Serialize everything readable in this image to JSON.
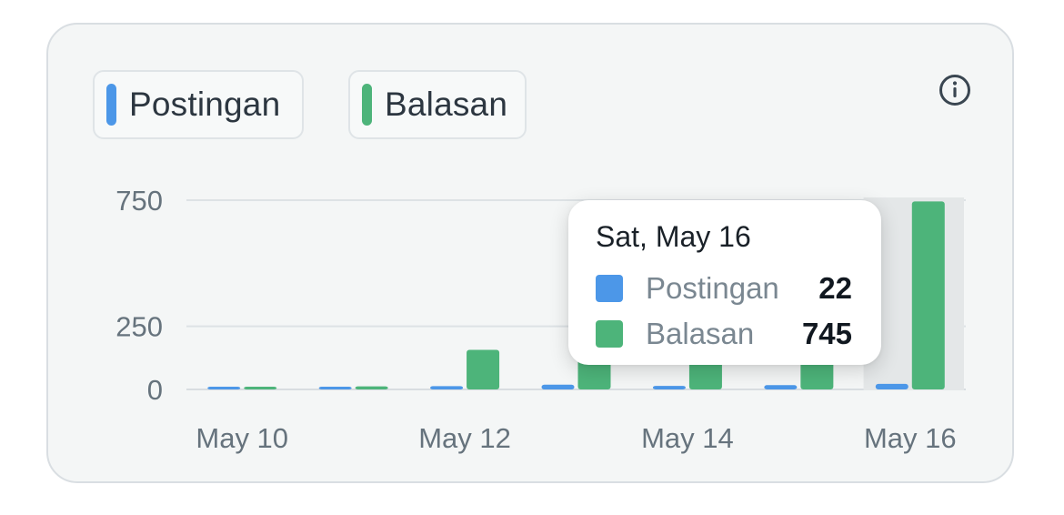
{
  "legend": {
    "items": [
      {
        "label": "Postingan",
        "color": "#4c97e8"
      },
      {
        "label": "Balasan",
        "color": "#4db47a"
      }
    ]
  },
  "info_icon": "info-circle-icon",
  "tooltip": {
    "title": "Sat, May 16",
    "rows": [
      {
        "label": "Postingan",
        "value": "22",
        "color": "#4c97e8"
      },
      {
        "label": "Balasan",
        "value": "745",
        "color": "#4db47a"
      }
    ]
  },
  "chart_data": {
    "type": "bar",
    "x_tick_labels": [
      "May 10",
      "May 12",
      "May 14",
      "May 16"
    ],
    "y_tick_labels": [
      "750",
      "250",
      "0"
    ],
    "y_ticks": [
      750,
      250,
      0
    ],
    "ylim": [
      0,
      750
    ],
    "grid": true,
    "legend_position": "top-left",
    "highlighted_index": 6,
    "categories": [
      "May 10",
      "May 11",
      "May 12",
      "May 13",
      "May 14",
      "May 15",
      "May 16"
    ],
    "series": [
      {
        "name": "Postingan",
        "color": "#4c97e8",
        "values": [
          2,
          3,
          13,
          19,
          14,
          17,
          22
        ]
      },
      {
        "name": "Balasan",
        "color": "#4db47a",
        "values": [
          3,
          12,
          157,
          160,
          150,
          155,
          745
        ]
      }
    ]
  }
}
